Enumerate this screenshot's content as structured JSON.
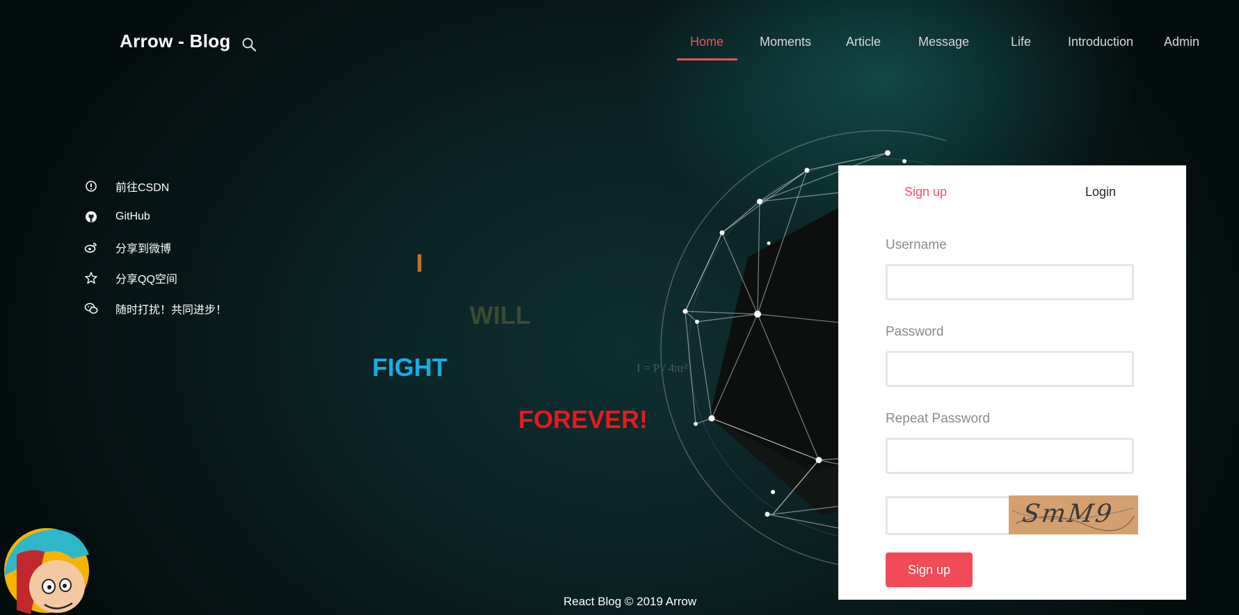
{
  "header": {
    "logo": "Arrow - Blog",
    "search_icon": "search-icon",
    "nav": [
      {
        "label": "Home",
        "active": true
      },
      {
        "label": "Moments"
      },
      {
        "label": "Article"
      },
      {
        "label": "Message"
      },
      {
        "label": "Life"
      },
      {
        "label": "Introduction"
      },
      {
        "label": "Admin"
      }
    ]
  },
  "sidebar": {
    "items": [
      {
        "label": "前往CSDN",
        "icon": "info-circle-icon"
      },
      {
        "label": "GitHub",
        "icon": "github-icon"
      },
      {
        "label": "分享到微博",
        "icon": "weibo-icon"
      },
      {
        "label": "分享QQ空间",
        "icon": "star-icon"
      },
      {
        "label": "随时打扰！共同进步！",
        "icon": "wechat-icon"
      }
    ]
  },
  "slogan": {
    "words": [
      "I",
      "WILL",
      "FIGHT",
      "FOREVER!"
    ],
    "colors": [
      "#c8702f",
      "#3b4a32",
      "#15aee6",
      "#e8191b"
    ]
  },
  "formula": "I = P / 4πr²",
  "form": {
    "tabs": {
      "signup": "Sign up",
      "login": "Login"
    },
    "active_tab": "signup",
    "username_label": "Username",
    "username_value": "",
    "password_label": "Password",
    "password_value": "",
    "repeat_label": "Repeat Password",
    "repeat_value": "",
    "captcha_value": "",
    "captcha_text": "SmM9",
    "submit_label": "Sign up"
  },
  "footer": {
    "text": "React Blog © 2019 Arrow"
  },
  "colors": {
    "accent": "#f4515e",
    "panel": "#ffffff"
  }
}
